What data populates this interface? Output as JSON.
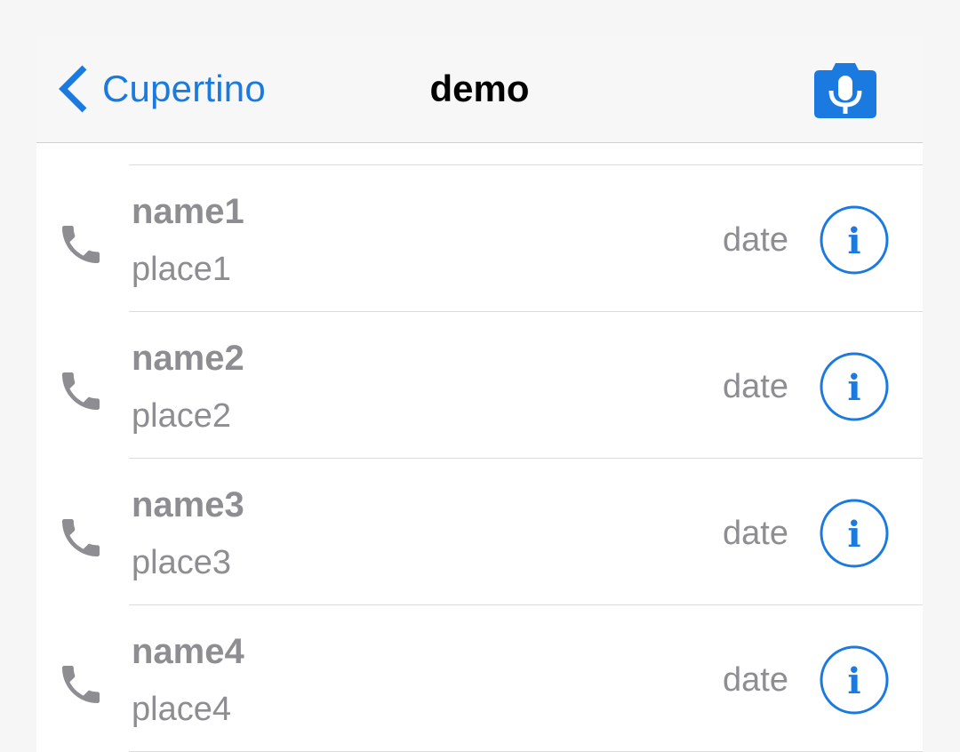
{
  "navbar": {
    "back_label": "Cupertino",
    "title": "demo",
    "back_icon": "chevron-left-icon",
    "action_icon": "camera-mic-icon"
  },
  "list": {
    "rows": [
      {
        "name": "name1",
        "place": "place1",
        "date": "date"
      },
      {
        "name": "name2",
        "place": "place2",
        "date": "date"
      },
      {
        "name": "name3",
        "place": "place3",
        "date": "date"
      },
      {
        "name": "name4",
        "place": "place4",
        "date": "date"
      }
    ]
  },
  "colors": {
    "accent": "#1a7ae0",
    "secondary_text": "#8e8e92",
    "separator": "#dcdcdf"
  }
}
